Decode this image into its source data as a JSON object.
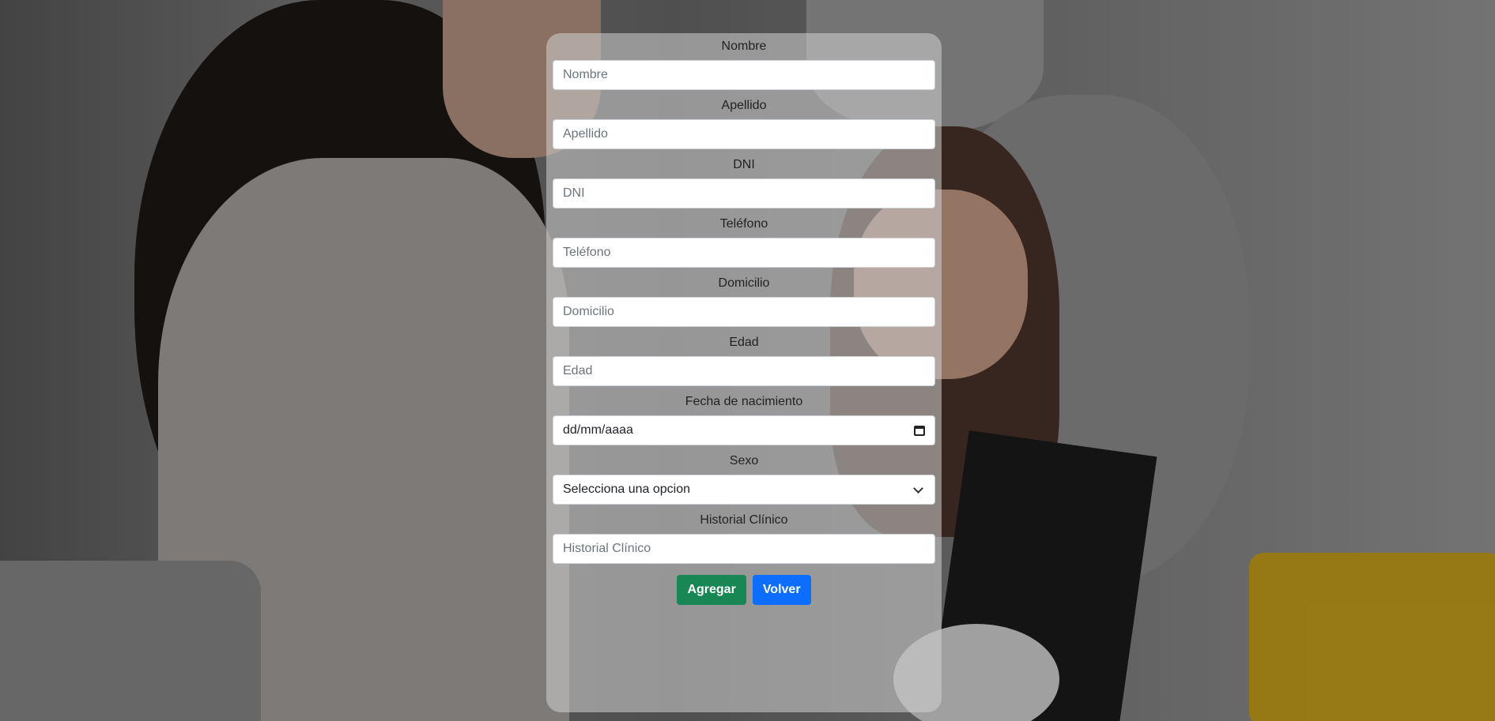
{
  "form": {
    "fields": [
      {
        "label": "Nombre",
        "placeholder": "Nombre"
      },
      {
        "label": "Apellido",
        "placeholder": "Apellido"
      },
      {
        "label": "DNI",
        "placeholder": "DNI"
      },
      {
        "label": "Teléfono",
        "placeholder": "Teléfono"
      },
      {
        "label": "Domicilio",
        "placeholder": "Domicilio"
      },
      {
        "label": "Edad",
        "placeholder": "Edad"
      }
    ],
    "birthdate": {
      "label": "Fecha de nacimiento",
      "value": "dd/mm/aaaa",
      "icon": "calendar-icon"
    },
    "sex": {
      "label": "Sexo",
      "selected": "Selecciona una opcion",
      "icon": "chevron-down-icon"
    },
    "history": {
      "label": "Historial Clínico",
      "placeholder": "Historial Clínico"
    },
    "buttons": {
      "add": "Agregar",
      "back": "Volver"
    }
  },
  "colors": {
    "add_button": "#198754",
    "back_button": "#0d6efd",
    "card_background": "rgba(210,210,210,0.55)"
  }
}
